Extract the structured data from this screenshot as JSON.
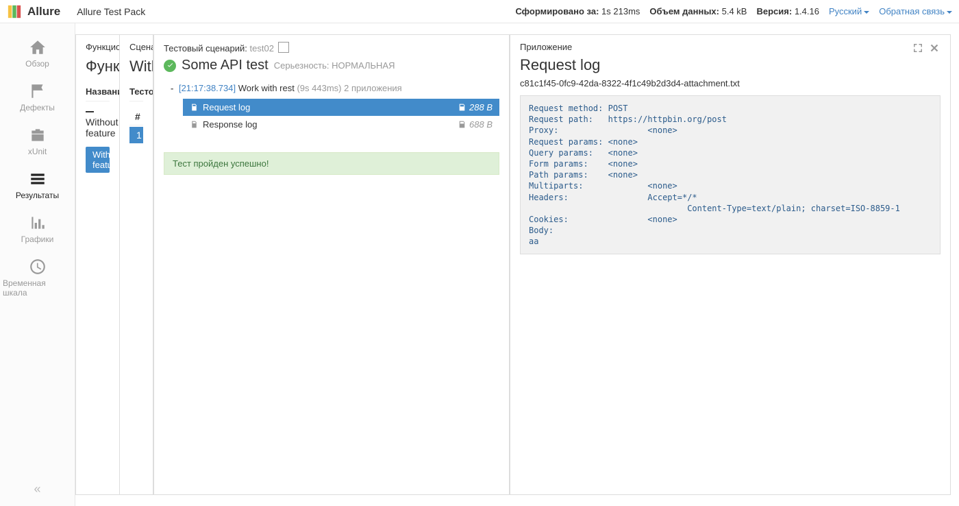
{
  "header": {
    "brand": "Allure",
    "subtitle": "Allure Test Pack",
    "generated_label": "Сформировано за:",
    "generated_value": "1s 213ms",
    "datasize_label": "Объем данных:",
    "datasize_value": "5.4 kB",
    "version_label": "Версия:",
    "version_value": "1.4.16",
    "language": "Русский",
    "feedback": "Обратная связь"
  },
  "sidebar": {
    "items": [
      {
        "label": "Обзор"
      },
      {
        "label": "Дефекты"
      },
      {
        "label": "xUnit"
      },
      {
        "label": "Результаты"
      },
      {
        "label": "Графики"
      },
      {
        "label": "Временная шкала"
      }
    ]
  },
  "col1": {
    "breadcrumb": "Функциональность",
    "heading": "Функции",
    "table_head": "Название",
    "row_label": "Without feature",
    "selected_label": "Without feature"
  },
  "col2": {
    "breadcrumb": "Сценарии",
    "heading": "Without feature",
    "table_head": "Тестовые",
    "hash": "#",
    "num": "1"
  },
  "col3": {
    "bc_label": "Тестовый сценарий:",
    "bc_value": "test02",
    "title": "Some API test",
    "severity_label": "Серьезность:",
    "severity_value": "НОРМАЛЬНАЯ",
    "step": {
      "toggle": "-",
      "ts": "[21:17:38.734]",
      "name": "Work with rest",
      "dur": "(9s 443ms)",
      "att_count": "2 приложения"
    },
    "attachments": [
      {
        "name": "Request log",
        "size": "288 B",
        "active": true
      },
      {
        "name": "Response log",
        "size": "688 B",
        "active": false
      }
    ],
    "success": "Тест пройден успешно!"
  },
  "col4": {
    "breadcrumb": "Приложение",
    "title": "Request log",
    "filename": "c81c1f45-0fc9-42da-8322-4f1c49b2d3d4-attachment.txt",
    "body": "Request method: POST\nRequest path:   https://httpbin.org/post\nProxy:                  <none>\nRequest params: <none>\nQuery params:   <none>\nForm params:    <none>\nPath params:    <none>\nMultiparts:             <none>\nHeaders:                Accept=*/*\n                                Content-Type=text/plain; charset=ISO-8859-1\nCookies:                <none>\nBody:\naa"
  }
}
